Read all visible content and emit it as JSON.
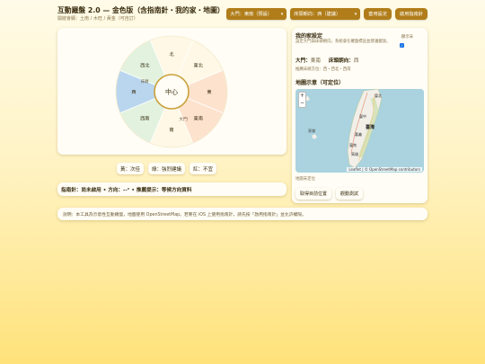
{
  "header": {
    "title": "互動羅盤 2.0 — 金色版（含指南針・我的家・地圖）",
    "subtitle": "開啟會顯：土南 / 木旺 / 黃金（可自訂）"
  },
  "controls": {
    "door_select": "大門：東南（預設）",
    "bed_select": "床頭朝向：西（建議）",
    "apply_button": "套用設定",
    "compass_button": "啟用指南針"
  },
  "compass": {
    "center_label": "中心",
    "sectors": [
      {
        "label": "北",
        "color": "#fff8e6"
      },
      {
        "label": "東北",
        "color": "#fff8e6"
      },
      {
        "label": "東",
        "color": "#fde2cd"
      },
      {
        "label": "東南",
        "color": "#fde2cd"
      },
      {
        "label": "南",
        "color": "#fff8e6"
      },
      {
        "label": "西南",
        "color": "#e2f2df"
      },
      {
        "label": "西",
        "color": "#b9d6ee"
      },
      {
        "label": "西北",
        "color": "#e2f2df"
      }
    ],
    "door_marker": "大門",
    "bed_marker": "床頭"
  },
  "legend": {
    "yellow": "黃：次佳",
    "green": "綠：強烈建議",
    "red": "紅：不宜"
  },
  "status": {
    "text": "指南針：尚未啟用 • 方向：--° • 推薦提示：等候方向資料"
  },
  "home": {
    "title": "我的家設定",
    "description": "設定大門與床頭朝向，系統會在羅盤標註並建議擺放。",
    "toggle_label": "顯示床",
    "door_label": "大門：",
    "door_value": "東南",
    "bed_label": "床頭朝向：",
    "bed_value": "西",
    "recommendation": "推薦床頭方位：西・西北・西南"
  },
  "map": {
    "title": "地圖示意（可定位）",
    "status": "地圖未定位",
    "attribution": "Leaflet | © OpenStreetMap contributors",
    "zoom_in": "+",
    "zoom_out": "−",
    "labels": [
      "臺北",
      "臺中",
      "嘉義",
      "臺南",
      "高雄",
      "臺灣",
      "澎湖",
      "金門"
    ]
  },
  "actions": {
    "locate_button": "取得目前位置",
    "pan_button": "觀動測試"
  },
  "note": {
    "text": "說明：本工具為示意性互動羅盤，地圖使用 OpenStreetMap。若要在 iOS 上使用指南針，請先按「啟用指南針」並允許權限。"
  },
  "colors": {
    "accent": "#b07d1a",
    "gold_ring": "#c9a13b"
  }
}
